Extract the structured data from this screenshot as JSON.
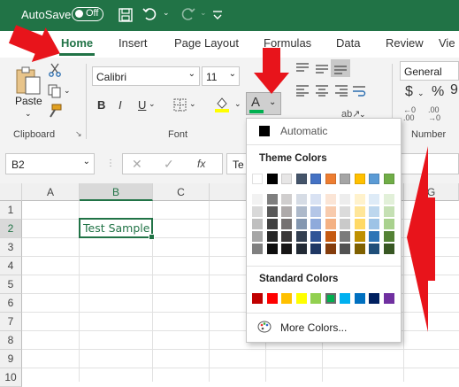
{
  "titlebar": {
    "autosave": "AutoSave",
    "toggle": "Off"
  },
  "tabs": [
    "Home",
    "Insert",
    "Page Layout",
    "Formulas",
    "Data",
    "Review",
    "Vie"
  ],
  "ribbon": {
    "paste": "Paste",
    "clipboard_label": "Clipboard",
    "font_name": "Calibri",
    "font_size": "11",
    "bold": "B",
    "italic": "I",
    "underline": "U",
    "font_label": "Font",
    "font_color_letter": "A",
    "number_format": "General",
    "currency": "$",
    "percent": "%",
    "comma": "9",
    "number_label": "Number"
  },
  "formula_bar": {
    "namebox": "B2",
    "fx": "fx",
    "content": "Te"
  },
  "grid": {
    "columns": [
      "A",
      "B",
      "C",
      "G"
    ],
    "rows": [
      "1",
      "2",
      "3",
      "4",
      "5",
      "6",
      "7",
      "8",
      "9",
      "10"
    ],
    "cell_b2": "Test Sample"
  },
  "color_menu": {
    "automatic": "Automatic",
    "theme_colors": "Theme Colors",
    "standard_colors": "Standard Colors",
    "more_colors": "More Colors...",
    "theme_row": [
      "#FFFFFF",
      "#000000",
      "#E7E6E6",
      "#44546A",
      "#4472C4",
      "#ED7D31",
      "#A5A5A5",
      "#FFC000",
      "#5B9BD5",
      "#70AD47"
    ],
    "shade_columns": [
      [
        "#F2F2F2",
        "#D9D9D9",
        "#BFBFBF",
        "#A6A6A6",
        "#808080"
      ],
      [
        "#7F7F7F",
        "#595959",
        "#404040",
        "#262626",
        "#0D0D0D"
      ],
      [
        "#D0CECE",
        "#AEAAAA",
        "#757171",
        "#3A3838",
        "#171616"
      ],
      [
        "#D6DCE5",
        "#ADB9CA",
        "#8497B0",
        "#333F50",
        "#222A35"
      ],
      [
        "#D9E2F3",
        "#B4C6E7",
        "#8EAADB",
        "#2F5496",
        "#1F3864"
      ],
      [
        "#FBE5D6",
        "#F8CBAD",
        "#F4B183",
        "#C55A11",
        "#843C0C"
      ],
      [
        "#EDEDED",
        "#DBDBDB",
        "#C9C9C9",
        "#7B7B7B",
        "#525252"
      ],
      [
        "#FFF2CC",
        "#FFE699",
        "#FFD966",
        "#BF9000",
        "#7F6000"
      ],
      [
        "#DEEBF7",
        "#BDD7EE",
        "#9DC3E6",
        "#2E75B6",
        "#1F4E79"
      ],
      [
        "#E2F0D9",
        "#C5E0B4",
        "#A9D18E",
        "#548235",
        "#385723"
      ]
    ],
    "standard_row": [
      "#C00000",
      "#FF0000",
      "#FFC000",
      "#FFFF00",
      "#92D050",
      "#00B050",
      "#00B0F0",
      "#0070C0",
      "#002060",
      "#7030A0"
    ]
  },
  "colors": {
    "excel_green": "#217346",
    "arrow_red": "#E8141B",
    "font_color_bar": "#00B050"
  }
}
